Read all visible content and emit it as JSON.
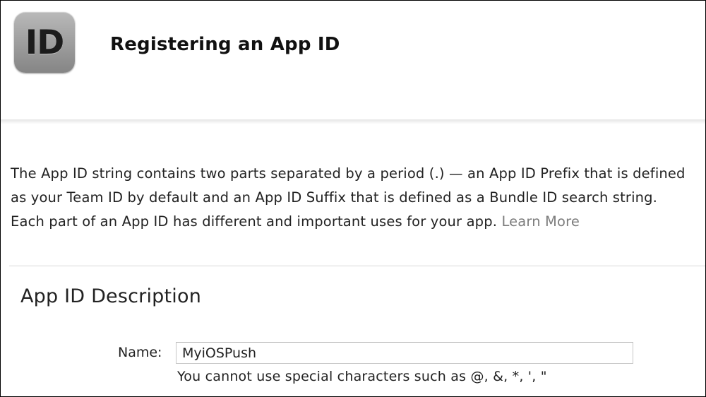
{
  "header": {
    "icon_text": "ID",
    "title": "Registering an App ID"
  },
  "intro": {
    "text": "The App ID string contains two parts separated by a period (.) — an App ID Prefix that is defined as your Team ID by default and an App ID Suffix that is defined as a Bundle ID search string. Each part of an App ID has different and important uses for your app.",
    "learn_more": "Learn More"
  },
  "description_section": {
    "title": "App ID Description",
    "name_label": "Name:",
    "name_value": "MyiOSPush",
    "hint": "You cannot use special characters such as @, &, *, ', \""
  }
}
